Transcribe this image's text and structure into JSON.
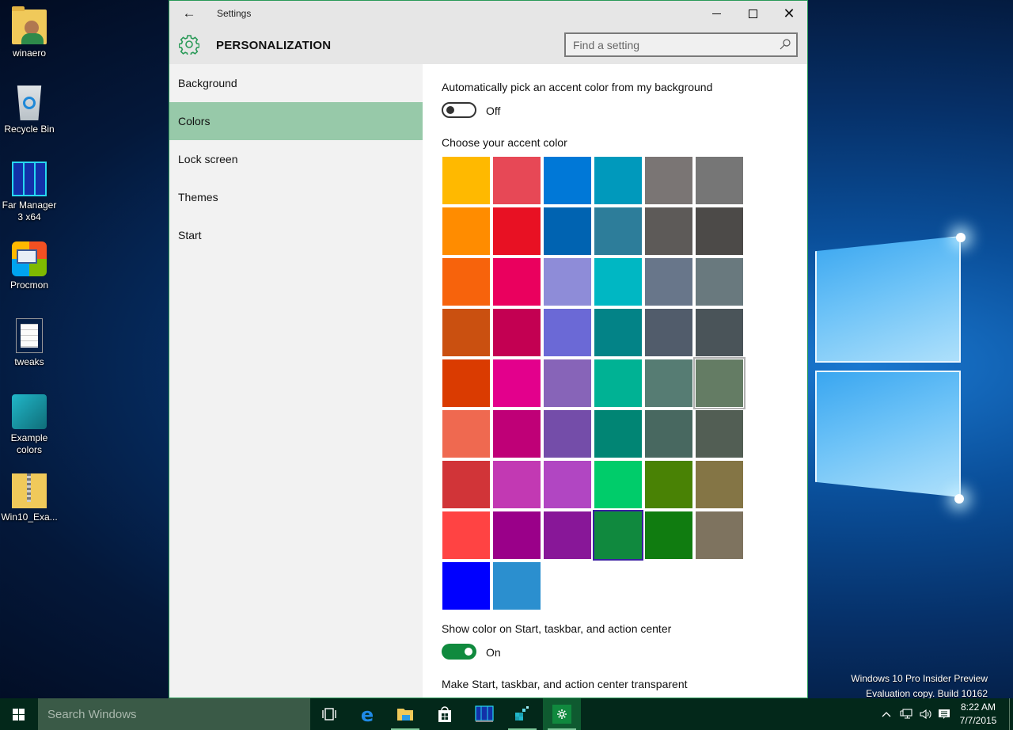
{
  "desktop": {
    "icons": [
      {
        "label": "winaero",
        "icon": "user-folder-icon"
      },
      {
        "label": "Recycle Bin",
        "icon": "recycle-bin-icon"
      },
      {
        "label": "Far Manager 3 x64",
        "icon": "far-manager-icon"
      },
      {
        "label": "Procmon",
        "icon": "procmon-icon"
      },
      {
        "label": "tweaks",
        "icon": "text-file-icon"
      },
      {
        "label": "Example colors",
        "icon": "registry-file-icon"
      },
      {
        "label": "Win10_Exa...",
        "icon": "zip-folder-icon"
      }
    ],
    "watermark": {
      "line1": "Windows 10 Pro Insider Preview",
      "line2": "Evaluation copy. Build 10162"
    }
  },
  "window": {
    "title": "Settings",
    "back_icon": "←",
    "minimize_icon": "minimize-icon",
    "maximize_icon": "maximize-icon",
    "close_glyph": "✕",
    "header": {
      "section_title": "PERSONALIZATION",
      "search_placeholder": "Find a setting"
    },
    "accent_color": "#2a9a58",
    "sidebar": {
      "items": [
        {
          "label": "Background",
          "active": false
        },
        {
          "label": "Colors",
          "active": true
        },
        {
          "label": "Lock screen",
          "active": false
        },
        {
          "label": "Themes",
          "active": false
        },
        {
          "label": "Start",
          "active": false
        }
      ]
    },
    "content": {
      "auto_pick_label": "Automatically pick an accent color from my background",
      "auto_pick_state": "Off",
      "choose_label": "Choose your accent color",
      "swatches": [
        [
          "#ffb900",
          "#e74856",
          "#0078d7",
          "#0099bc",
          "#7a7574",
          "#767676"
        ],
        [
          "#ff8c00",
          "#e81123",
          "#0063b1",
          "#2d7d9a",
          "#5d5a58",
          "#4c4a48"
        ],
        [
          "#f7630c",
          "#ea005e",
          "#8e8cd8",
          "#00b7c3",
          "#68768a",
          "#69797e"
        ],
        [
          "#ca5010",
          "#c30052",
          "#6b69d6",
          "#038387",
          "#515c6b",
          "#4a5459"
        ],
        [
          "#da3b01",
          "#e3008c",
          "#8764b8",
          "#00b294",
          "#567c73",
          "#647c64"
        ],
        [
          "#ef6950",
          "#bf0077",
          "#744da9",
          "#018574",
          "#486860",
          "#525e54"
        ],
        [
          "#d13438",
          "#c239b3",
          "#b146c2",
          "#00cc6a",
          "#498205",
          "#847545"
        ],
        [
          "#ff4343",
          "#9a0089",
          "#881798",
          "#10893e",
          "#107c10",
          "#7e735f"
        ],
        [
          "#0000ff",
          "#2b8fcf"
        ]
      ],
      "selected_swatch": "#10893e",
      "hovered_swatch": "#647c64",
      "show_color_label": "Show color on Start, taskbar, and action center",
      "show_color_state": "On",
      "transparent_label": "Make Start, taskbar, and action center transparent"
    }
  },
  "taskbar": {
    "search_placeholder": "Search Windows",
    "apps": [
      {
        "name": "task-view",
        "running": false,
        "active": false
      },
      {
        "name": "edge",
        "running": false,
        "active": false
      },
      {
        "name": "file-explorer",
        "running": true,
        "active": false
      },
      {
        "name": "store",
        "running": false,
        "active": false
      },
      {
        "name": "far-manager",
        "running": false,
        "active": false
      },
      {
        "name": "registry-editor",
        "running": true,
        "active": false
      },
      {
        "name": "settings",
        "running": true,
        "active": true
      }
    ],
    "tray": {
      "chevron": "^",
      "time": "8:22 AM",
      "date": "7/7/2015"
    }
  }
}
